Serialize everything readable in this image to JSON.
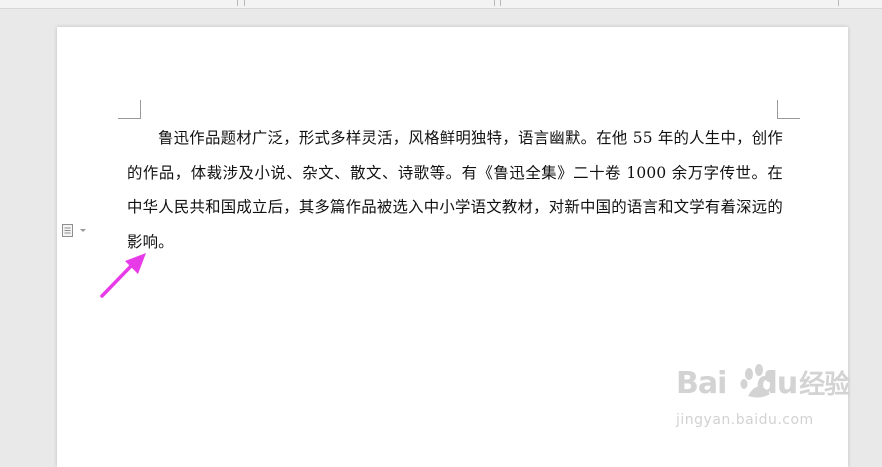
{
  "document": {
    "paragraph": "鲁迅作品题材广泛，形式多样灵活，风格鲜明独特，语言幽默。在他 55 年的人生中，创作的作品，体裁涉及小说、杂文、散文、诗歌等。有《鲁迅全集》二十卷 1000 余万字传世。在中华人民共和国成立后，其多篇作品被选入中小学语文教材，对新中国的语言和文学有着深远的影响。"
  },
  "watermark": {
    "brand_prefix": "Bai",
    "brand_suffix": "du",
    "brand_cn": "经验",
    "url": "jingyan.baidu.com"
  },
  "annotation": {
    "arrow_color": "#e83be8"
  },
  "icons": {
    "paragraph_options": "paragraph-options-icon",
    "arrow": "arrow-icon"
  }
}
